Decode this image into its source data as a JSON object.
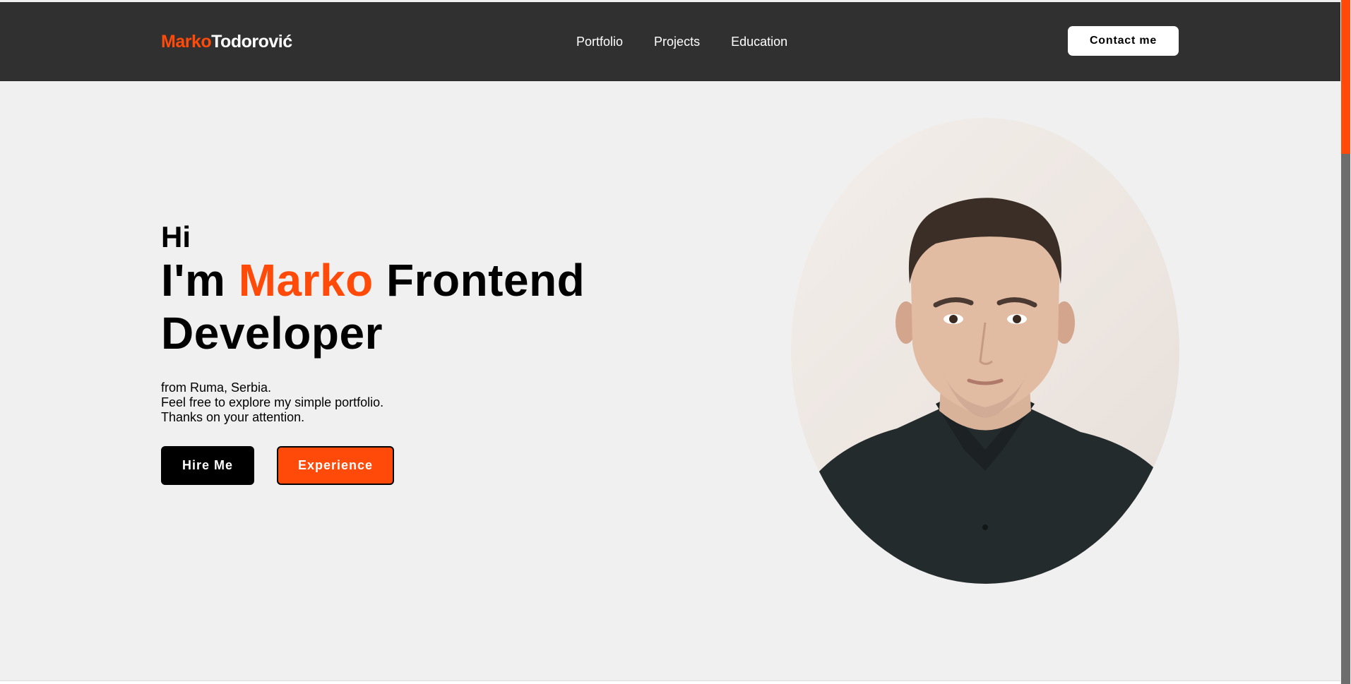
{
  "header": {
    "logo_first": "Marko",
    "logo_last": "Todorović",
    "nav": [
      {
        "label": "Portfolio"
      },
      {
        "label": "Projects"
      },
      {
        "label": "Education"
      }
    ],
    "contact_label": "Contact me"
  },
  "hero": {
    "greeting": "Hi",
    "headline_prefix": "I'm ",
    "headline_name": "Marko",
    "headline_suffix_1": " Frontend",
    "headline_suffix_2": "Developer",
    "description": [
      "from Ruma, Serbia.",
      "Feel free to explore my simple portfolio.",
      "Thanks on your attention."
    ],
    "hire_label": "Hire Me",
    "experience_label": "Experience"
  },
  "portrait": {
    "icon": "profile-photo"
  },
  "colors": {
    "accent": "#ff4a0a",
    "header_bg": "#303030",
    "page_bg": "#f0f0f0"
  }
}
